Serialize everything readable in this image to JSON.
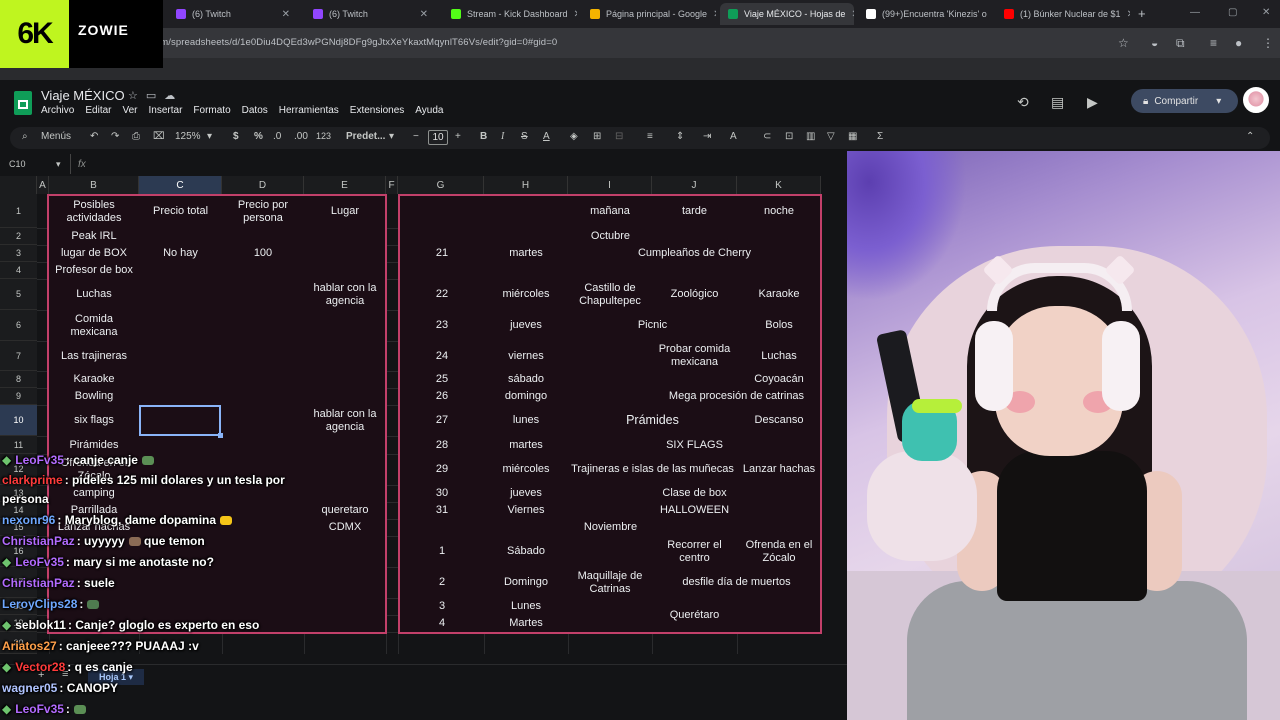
{
  "browser": {
    "tabs": [
      {
        "label": "(6) Twitch",
        "icon_color": "#9146ff"
      },
      {
        "label": "(6) Twitch",
        "icon_color": "#9146ff"
      },
      {
        "label": "Stream - Kick Dashboard",
        "icon_color": "#53fc18"
      },
      {
        "label": "Página principal - Google",
        "icon_color": "#f4b400"
      },
      {
        "label": "Viaje MÉXICO - Hojas de",
        "icon_color": "#0f9d58"
      },
      {
        "label": "(99+)Encuentra 'Kinezis' o",
        "icon_color": "#ffffff"
      },
      {
        "label": "(1) Búnker Nuclear de $1",
        "icon_color": "#ff0000"
      }
    ],
    "url": "com/spreadsheets/d/1e0Diu4DQEd3wPGNdj8DFg9gJtxXeYkaxtMqynlT66Vs/edit?gid=0#gid=0"
  },
  "overlay_logo": {
    "mark": "6K",
    "brand": "ZOWIE"
  },
  "sheets": {
    "title": "Viaje MÉXICO",
    "menu": [
      "Archivo",
      "Editar",
      "Ver",
      "Insertar",
      "Formato",
      "Datos",
      "Herramientas",
      "Extensiones",
      "Ayuda"
    ],
    "share_label": "Compartir",
    "toolbar": {
      "search": "Menús",
      "zoom": "125%",
      "currency": "$",
      "percent": "%",
      "dec_minus": ".0",
      "dec_plus": ".00",
      "number_format": "123",
      "font": "Predet...",
      "font_size": "10"
    },
    "name_box": "C10",
    "fx": "fx",
    "columns": [
      "A",
      "B",
      "C",
      "D",
      "E",
      "F",
      "G",
      "H",
      "I",
      "J",
      "K"
    ],
    "rows": [
      "1",
      "2",
      "3",
      "4",
      "5",
      "6",
      "7",
      "8",
      "9",
      "10",
      "11",
      "12",
      "13",
      "14",
      "15",
      "16",
      "17",
      "18",
      "19",
      "20"
    ],
    "sheet_tab": "Hoja 1",
    "left_table": {
      "header": {
        "b": "Posibles actividades",
        "c": "Precio total",
        "d": "Precio por persona",
        "e": "Lugar"
      },
      "rows": [
        {
          "b": "Peak IRL",
          "c": "",
          "d": "",
          "e": ""
        },
        {
          "b": "lugar de BOX",
          "c": "No hay",
          "d": "100",
          "e": ""
        },
        {
          "b": "Profesor de box",
          "c": "",
          "d": "",
          "e": ""
        },
        {
          "b": "Luchas",
          "c": "",
          "d": "",
          "e": "hablar con la agencia"
        },
        {
          "b": "Comida mexicana",
          "c": "",
          "d": "",
          "e": ""
        },
        {
          "b": "Las trajineras",
          "c": "",
          "d": "",
          "e": ""
        },
        {
          "b": "Karaoke",
          "c": "",
          "d": "",
          "e": ""
        },
        {
          "b": "Bowling",
          "c": "",
          "d": "",
          "e": ""
        },
        {
          "b": "six flags",
          "c": "",
          "d": "",
          "e": "hablar con la agencia"
        },
        {
          "b": "Pirámides",
          "c": "",
          "d": "",
          "e": ""
        },
        {
          "b": "Ofrenda en el Zócalo",
          "c": "",
          "d": "",
          "e": ""
        },
        {
          "b": "camping",
          "c": "",
          "d": "",
          "e": ""
        },
        {
          "b": "Parrillada",
          "c": "",
          "d": "",
          "e": "queretaro"
        },
        {
          "b": "Lanzar hachas",
          "c": "",
          "d": "",
          "e": "CDMX"
        }
      ]
    },
    "right_table": {
      "header": {
        "i": "mañana",
        "j": "tarde",
        "k": "noche"
      },
      "month1": "Octubre",
      "month2": "Noviembre",
      "rows": [
        {
          "g": "21",
          "h": "martes",
          "i": "",
          "j": "Cumpleaños de Cherry",
          "k": ""
        },
        {
          "g": "",
          "h": "",
          "i": "",
          "j": "",
          "k": ""
        },
        {
          "g": "22",
          "h": "miércoles",
          "i": "Castillo de Chapultepec",
          "j": "Zoológico",
          "k": "Karaoke"
        },
        {
          "g": "23",
          "h": "jueves",
          "i": "",
          "j": "Picnic",
          "k": "Bolos"
        },
        {
          "g": "24",
          "h": "viernes",
          "i": "",
          "j": "Probar comida mexicana",
          "k": "Luchas"
        },
        {
          "g": "25",
          "h": "sábado",
          "i": "",
          "j": "",
          "k": "Coyoacán"
        },
        {
          "g": "26",
          "h": "domingo",
          "i": "",
          "j": "Mega procesión de catrinas",
          "k": ""
        },
        {
          "g": "27",
          "h": "lunes",
          "i": "",
          "j": "Prámides",
          "k": "Descanso"
        },
        {
          "g": "28",
          "h": "martes",
          "i": "",
          "j": "SIX FLAGS",
          "k": ""
        },
        {
          "g": "29",
          "h": "miércoles",
          "i": "",
          "j": "Trajineras e islas de las muñecas",
          "k": "Lanzar hachas"
        },
        {
          "g": "30",
          "h": "jueves",
          "i": "",
          "j": "Clase de box",
          "k": ""
        },
        {
          "g": "31",
          "h": "Viernes",
          "i": "",
          "j": "HALLOWEEN",
          "k": ""
        },
        {
          "g": "1",
          "h": "Sábado",
          "i": "",
          "j": "Recorrer el centro",
          "k": "Ofrenda en el Zócalo"
        },
        {
          "g": "2",
          "h": "Domingo",
          "i": "Maquillaje de Catrinas",
          "j": "desfile día de muertos",
          "k": ""
        },
        {
          "g": "3",
          "h": "Lunes",
          "i": "",
          "j": "Querétaro",
          "k": ""
        },
        {
          "g": "4",
          "h": "Martes",
          "i": "",
          "j": "",
          "k": ""
        }
      ]
    }
  },
  "chat": [
    {
      "user": "LeoFv35",
      "text": ": canje canje",
      "color": "#b36bff",
      "badge": true,
      "emote": "#5b8f55"
    },
    {
      "user": "clarkprime",
      "text": ": pideles 125 mil dolares y un tesla por",
      "color": "#ff3b3b",
      "badge": false,
      "emote": ""
    },
    {
      "user": "persona",
      "text": "",
      "color": "#ffffff",
      "badge": false,
      "emote": ""
    },
    {
      "user": "nexonr96",
      "text": ": Maryblog, dame dopamina",
      "color": "#6fa8ff",
      "badge": false,
      "emote": "#f5c518"
    },
    {
      "user": "ChristianPaz",
      "text": ": uyyyyy",
      "color": "#b36bff",
      "badge": false,
      "emote": "#8a6b55",
      "after": " que temon"
    },
    {
      "user": "LeoFv35",
      "text": ": mary si me anotaste no?",
      "color": "#b36bff",
      "badge": true,
      "emote": ""
    },
    {
      "user": "ChristianPaz",
      "text": ": suele",
      "color": "#b36bff",
      "badge": false,
      "emote": ""
    },
    {
      "user": "LeroyClips28",
      "text": ":",
      "color": "#6fa8ff",
      "badge": false,
      "emote": "#4f7a4f"
    },
    {
      "user": "seblok11",
      "text": ": Canje? gloglo es experto en eso",
      "color": "#ffffff",
      "badge": true,
      "emote": ""
    },
    {
      "user": "Ariatos27",
      "text": ": canjeee??? PUAAAJ :v",
      "color": "#ffa04a",
      "badge": false,
      "emote": ""
    },
    {
      "user": "Vector28",
      "text": ": q es canje",
      "color": "#ff3b3b",
      "badge": true,
      "emote": ""
    },
    {
      "user": "wagner05",
      "text": ": CANOPY",
      "color": "#b0c4ff",
      "badge": false,
      "emote": ""
    },
    {
      "user": "LeoFv35",
      "text": ":",
      "color": "#b36bff",
      "badge": true,
      "emote": "#5b8f55"
    }
  ]
}
